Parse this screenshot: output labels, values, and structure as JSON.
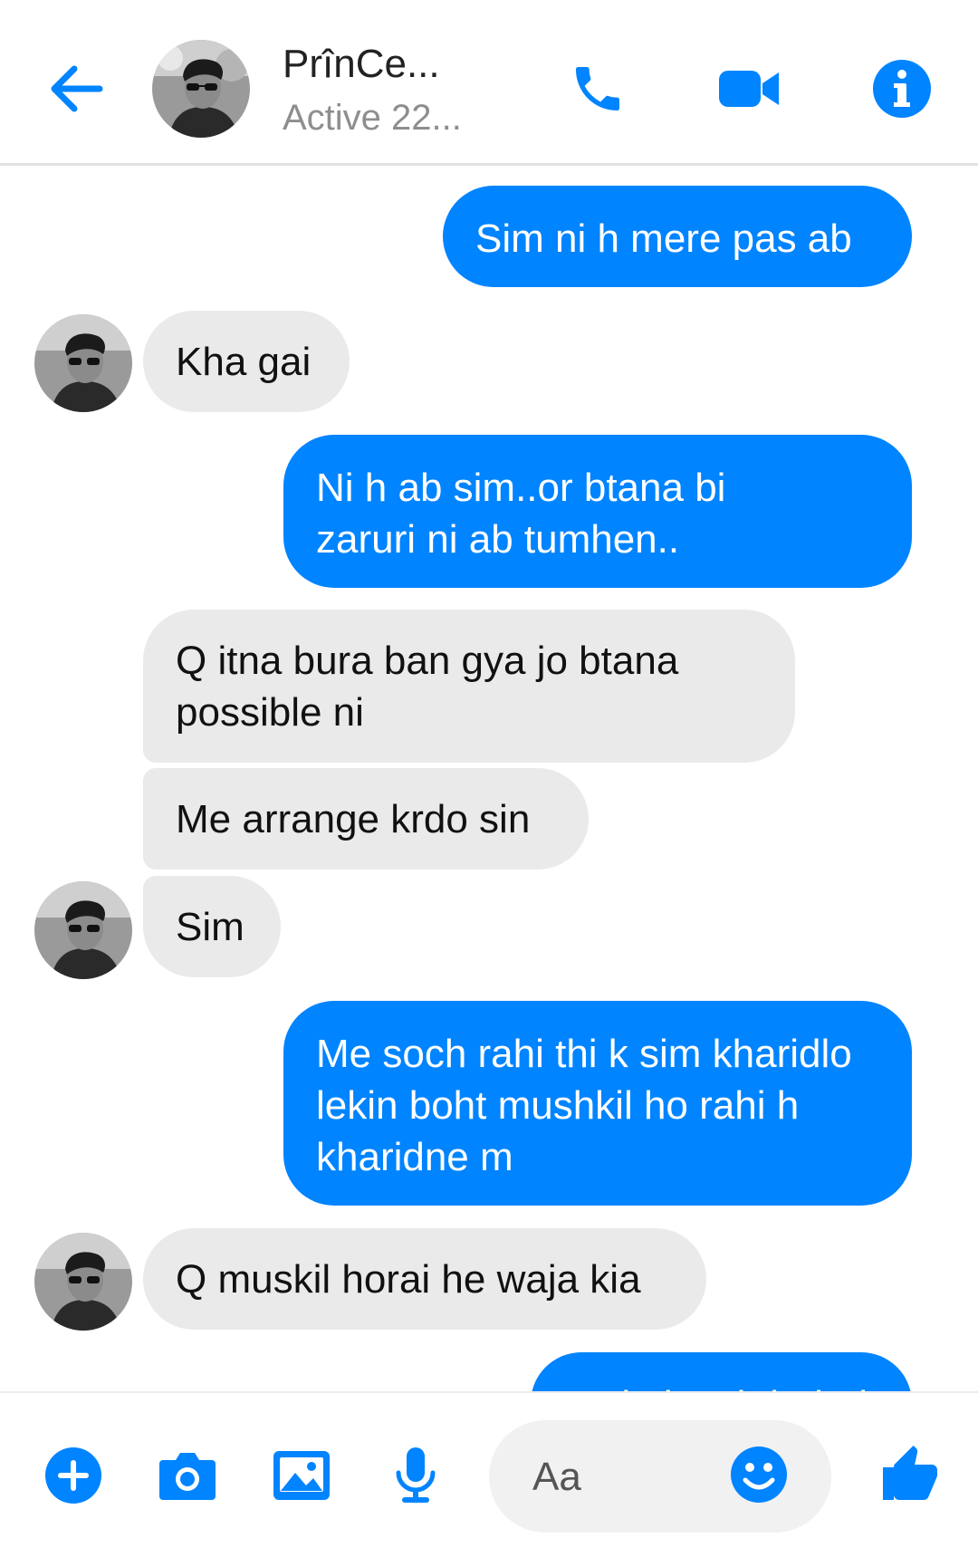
{
  "header": {
    "contact_name": "PrînCe...",
    "contact_status": "Active 22...",
    "icons": [
      "back-arrow-icon",
      "phone-icon",
      "video-camera-icon",
      "info-icon"
    ],
    "accent_color": "#0084ff"
  },
  "messages": [
    {
      "direction": "outgoing",
      "text": "Sim ni h mere pas ab"
    },
    {
      "direction": "incoming",
      "text": "Kha gai"
    },
    {
      "direction": "outgoing",
      "text": "Ni h ab sim..or btana bi zaruri ni ab tumhen.."
    },
    {
      "direction": "incoming",
      "text": "Q itna bura ban gya jo btana possible ni"
    },
    {
      "direction": "incoming",
      "text": "Me arrange krdo sin"
    },
    {
      "direction": "incoming",
      "text": "Sim"
    },
    {
      "direction": "outgoing",
      "text": "Me soch rahi thi k sim kharidlo lekin boht mushkil ho rahi h kharidne m"
    },
    {
      "direction": "incoming",
      "text": "Q muskil horai he waja kia"
    },
    {
      "direction": "outgoing",
      "text": "Waja kya h boht h..."
    }
  ],
  "composer": {
    "placeholder": "Aa",
    "icons": [
      "plus-icon",
      "camera-icon",
      "image-icon",
      "microphone-icon",
      "emoji-icon",
      "thumbs-up-icon"
    ]
  },
  "colors": {
    "outgoing_bubble": "#0084ff",
    "incoming_bubble": "#eaeaea",
    "muted_text": "#8e8e8e"
  }
}
